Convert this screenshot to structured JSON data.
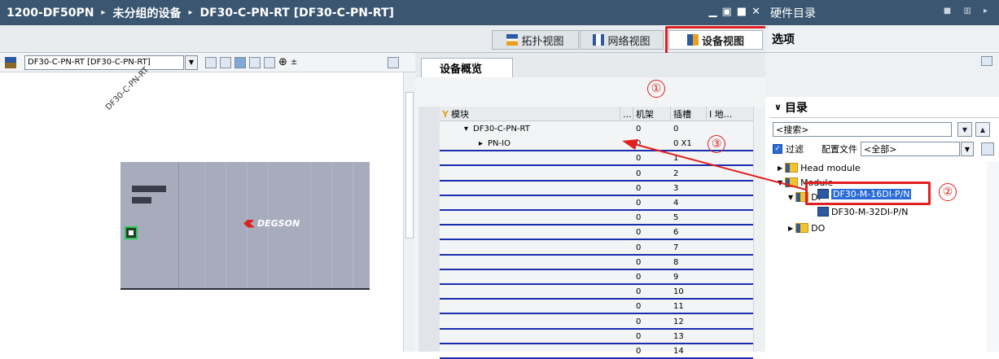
{
  "window": {
    "breadcrumb": [
      "1200-DF50PN",
      "未分组的设备",
      "DF30-C-PN-RT [DF30-C-PN-RT]"
    ],
    "sep": "▸"
  },
  "hw_catalog": {
    "title": "硬件目录",
    "options": "选项",
    "catalog_header": "目录"
  },
  "view_tabs": [
    {
      "label": "拓扑视图"
    },
    {
      "label": "网络视图"
    },
    {
      "label": "设备视图",
      "active": true
    }
  ],
  "toolbar": {
    "device_select": "DF30-C-PN-RT [DF30-C-PN-RT]"
  },
  "canvas": {
    "device_label": "DF30-C-PN-RT",
    "logo": "DEGSON"
  },
  "overview": {
    "tab": "设备概览",
    "columns": [
      "模块",
      "...",
      "机架",
      "插槽",
      "I 地..."
    ],
    "rows": [
      {
        "module": "DF30-C-PN-RT",
        "rack": "0",
        "slot": "0",
        "expand": "▾"
      },
      {
        "module": "PN-IO",
        "rack": "0",
        "slot": "0 X1",
        "expand": "▸"
      },
      {
        "module": "",
        "rack": "0",
        "slot": "1"
      },
      {
        "module": "",
        "rack": "0",
        "slot": "2"
      },
      {
        "module": "",
        "rack": "0",
        "slot": "3"
      },
      {
        "module": "",
        "rack": "0",
        "slot": "4"
      },
      {
        "module": "",
        "rack": "0",
        "slot": "5"
      },
      {
        "module": "",
        "rack": "0",
        "slot": "6"
      },
      {
        "module": "",
        "rack": "0",
        "slot": "7"
      },
      {
        "module": "",
        "rack": "0",
        "slot": "8"
      },
      {
        "module": "",
        "rack": "0",
        "slot": "9"
      },
      {
        "module": "",
        "rack": "0",
        "slot": "10"
      },
      {
        "module": "",
        "rack": "0",
        "slot": "11"
      },
      {
        "module": "",
        "rack": "0",
        "slot": "12"
      },
      {
        "module": "",
        "rack": "0",
        "slot": "13"
      },
      {
        "module": "",
        "rack": "0",
        "slot": "14"
      }
    ]
  },
  "catalog": {
    "search_placeholder": "<搜索>",
    "filter_label": "过滤",
    "profile_label": "配置文件",
    "profile_value": "<全部>",
    "tree": {
      "head_module": "Head module",
      "module": "Module",
      "di": "DI",
      "item1": "DF30-M-16DI-P/N",
      "item2": "DF30-M-32DI-P/N",
      "do": "DO"
    }
  },
  "annotations": {
    "n1": "①",
    "n2": "②",
    "n3": "③"
  },
  "colors": {
    "titlebar": "#3a5670",
    "highlight": "#e02020",
    "selection": "#2a6bd6",
    "row_line": "#1a2db0"
  }
}
